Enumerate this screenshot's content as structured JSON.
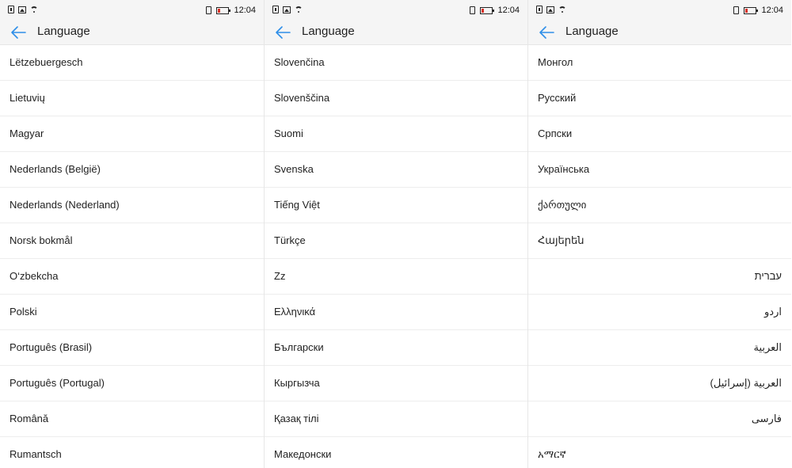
{
  "status": {
    "time": "12:04",
    "left_icons": [
      "alert-icon",
      "image-icon",
      "wifi-icon"
    ],
    "right_icons": [
      "sim-icon",
      "battery-icon"
    ],
    "battery_color": "#d93025"
  },
  "colors": {
    "accent": "#2f8fe8",
    "background": "#f5f5f5",
    "list_background": "#ffffff",
    "divider": "#ededed"
  },
  "panels": [
    {
      "title": "Language",
      "items": [
        "Lëtzebuergesch",
        "Lietuvių",
        "Magyar",
        "Nederlands (België)",
        "Nederlands (Nederland)",
        "Norsk bokmål",
        "O‘zbekcha",
        "Polski",
        "Português (Brasil)",
        "Português (Portugal)",
        "Română",
        "Rumantsch"
      ]
    },
    {
      "title": "Language",
      "items": [
        "Slovenčina",
        "Slovenščina",
        "Suomi",
        "Svenska",
        "Tiếng Việt",
        "Türkçe",
        "Zz",
        "Ελληνικά",
        "Български",
        "Кыргызча",
        "Қазақ тілі",
        "Македонски"
      ]
    },
    {
      "title": "Language",
      "items": [
        "Монгол",
        "Русский",
        "Српски",
        "Українська",
        "ქართული",
        "Հայերեն",
        "עברית",
        "اردو",
        "العربية",
        "العربية (إسرائيل)",
        "فارسی",
        "አማርኛ"
      ],
      "rtl_items": [
        6,
        7,
        8,
        9,
        10
      ]
    }
  ]
}
